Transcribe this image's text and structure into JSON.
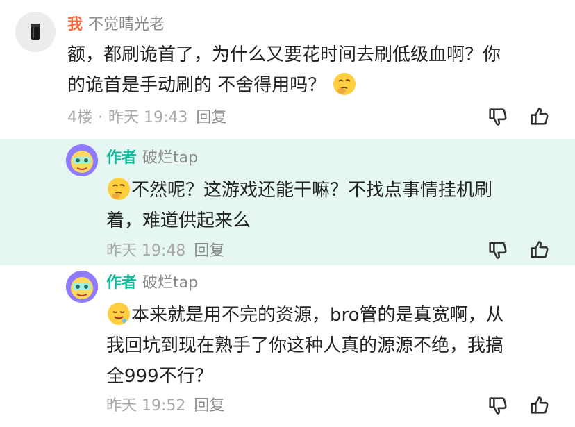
{
  "comments": [
    {
      "tag": "我",
      "user": "不觉晴光老",
      "text_line1": "额，都刷诡首了，为什么又要花时间去刷低级血啊？你",
      "text_line2": "的诡首是手动刷的 不舍得用吗？",
      "floor": "4楼",
      "dot": "·",
      "time": "昨天 19:43",
      "reply": "回复"
    },
    {
      "tag": "作者",
      "user": "破烂tap",
      "text_line1": "不然呢？这游戏还能干嘛？不找点事情挂机刷",
      "text_line2": "着，难道供起来么",
      "time": "昨天 19:48",
      "reply": "回复"
    },
    {
      "tag": "作者",
      "user": "破烂tap",
      "text_line1": "本来就是用不完的资源，bro管的是真宽啊，从",
      "text_line2": "我回坑到现在熟手了你这种人真的源源不绝，我搞",
      "text_line3": "全999不行？",
      "time": "昨天 19:52",
      "reply": "回复"
    }
  ],
  "icons": {
    "dislike": "thumbs-down-icon",
    "like": "thumbs-up-icon",
    "emoji_thinking": "thinking-face-emoji",
    "emoji_drool": "drooling-face-emoji"
  },
  "colors": {
    "author_tag": "#12b99a",
    "me_tag": "#ff6a3d",
    "highlight_bg": "#e6f7f3",
    "meta_gray": "#a8a8a8"
  }
}
